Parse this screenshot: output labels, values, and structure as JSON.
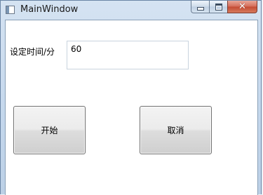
{
  "window": {
    "title": "MainWindow",
    "caption_buttons": {
      "minimize_icon": "minimize-icon",
      "maximize_icon": "maximize-icon",
      "close_icon": "close-icon",
      "close_glyph": "✕"
    }
  },
  "form": {
    "time_label": "设定时间/分",
    "time_value": "60"
  },
  "buttons": {
    "start_label": "开始",
    "cancel_label": "取消"
  },
  "colors": {
    "close_button": "#c44a33",
    "frame": "#c4d7ec"
  }
}
